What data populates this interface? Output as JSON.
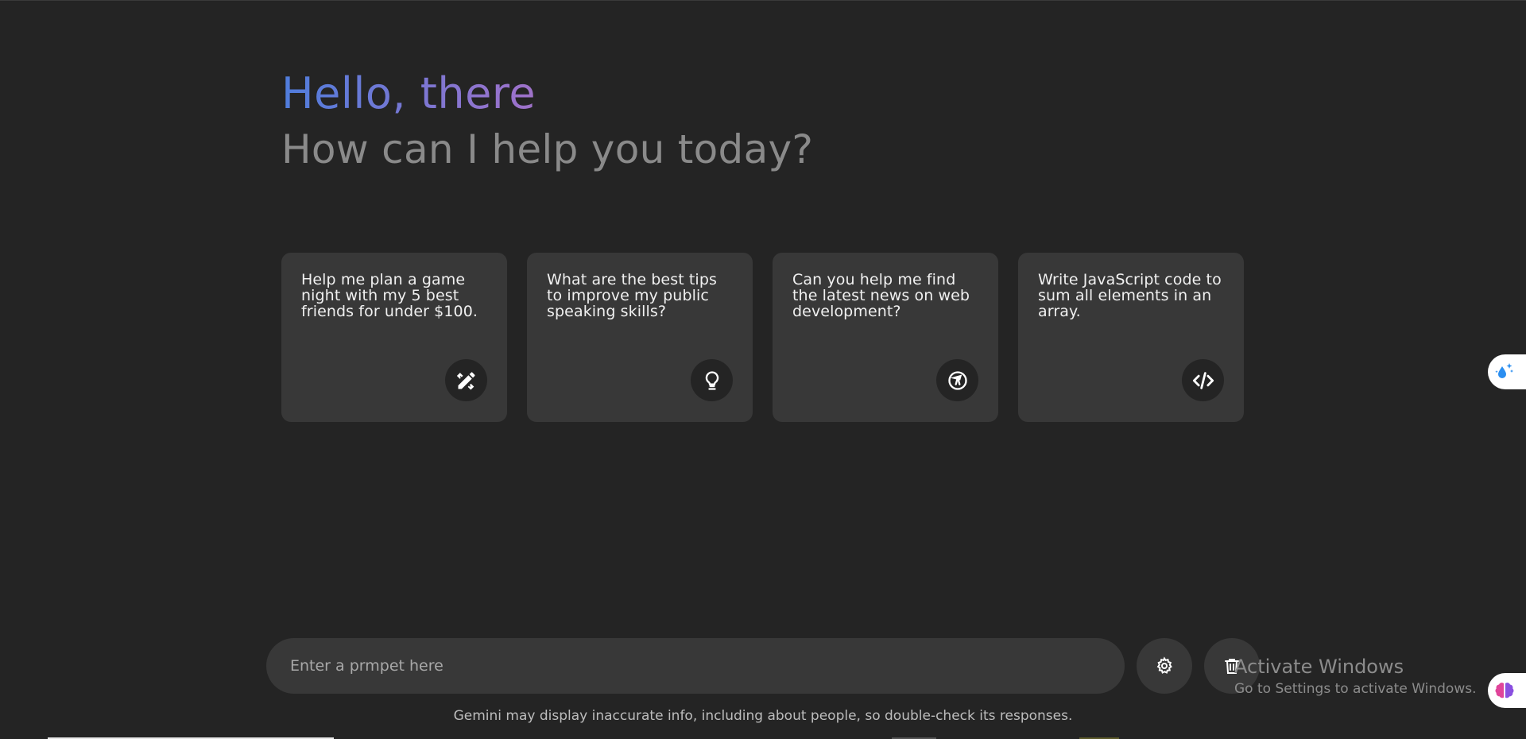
{
  "header": {
    "greeting": "Hello, there",
    "subtitle": "How can I help you today?"
  },
  "suggestions": [
    {
      "text": "Help me plan a game night with my 5 best friends for under $100.",
      "icon": "pencil-ruler-icon"
    },
    {
      "text": "What are the best tips to improve my public speaking skills?",
      "icon": "lightbulb-icon"
    },
    {
      "text": "Can you help me find the latest news on web development?",
      "icon": "explore-icon"
    },
    {
      "text": "Write JavaScript code to sum all elements in an array.",
      "icon": "code-icon"
    }
  ],
  "prompt": {
    "placeholder": "Enter a prmpet here",
    "value": ""
  },
  "buttons": {
    "settings_icon": "gear-icon",
    "delete_icon": "trash-icon"
  },
  "disclaimer": "Gemini may display inaccurate info, including about people, so double-check its responses.",
  "watermark": {
    "title": "Activate Windows",
    "subtitle": "Go to Settings to activate Windows."
  },
  "colors": {
    "background": "#242424",
    "card": "#383838",
    "gradient_start": "#4f7ddc",
    "gradient_mid": "#9b72cb",
    "gradient_end": "#d96570"
  }
}
